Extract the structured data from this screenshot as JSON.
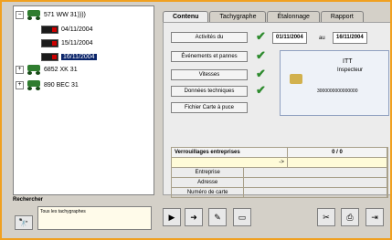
{
  "tree": {
    "vehicles": [
      {
        "label": "571 WW 31))))",
        "expanded": true,
        "cards": [
          "04/11/2004",
          "15/11/2004",
          "16/11/2004"
        ],
        "selected_card": "16/11/2004"
      },
      {
        "label": "6852 XK 31",
        "expanded": false
      },
      {
        "label": "890 BEC 31",
        "expanded": false
      }
    ]
  },
  "search": {
    "label": "Rechercher",
    "value": "Tous les tachygraphes"
  },
  "tabs": [
    "Contenu",
    "Tachygraphe",
    "Étalonnage",
    "Rapport"
  ],
  "active_tab": "Contenu",
  "content": {
    "activites_label": "Activités du",
    "date_from": "01/11/2004",
    "date_to_label": "au",
    "date_to": "16/11/2004",
    "evenements_label": "Événements et pannes",
    "vitesses_label": "Vitesses",
    "donnees_label": "Données techniques",
    "fichier_label": "Fichier Carte à puce",
    "card_type": "ITT",
    "card_role": "Inspecteur",
    "card_number": "3000000000000000",
    "verrouillages_title": "Verrouillages entreprises",
    "verrouillages_count": "0 / 0",
    "arrow": "->",
    "fields": [
      "Entreprise",
      "Adresse",
      "Numéro de carte"
    ]
  }
}
